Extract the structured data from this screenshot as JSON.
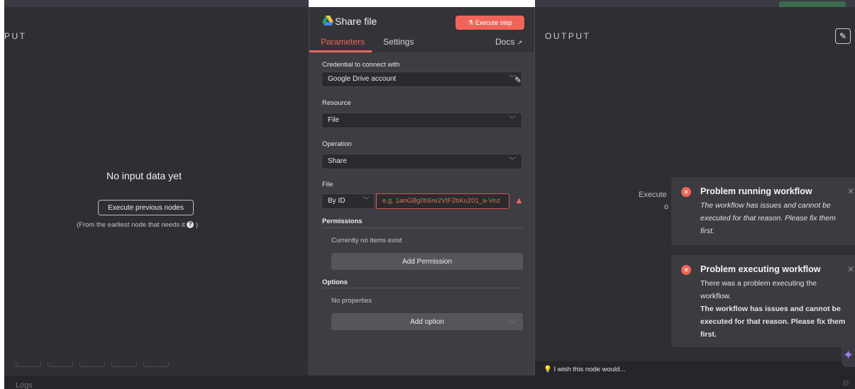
{
  "input_panel": {
    "heading": "PUT",
    "empty_title": "No input data yet",
    "execute_previous_label": "Execute previous nodes",
    "hint": "(From the earliest node that needs it",
    "hint_close": ")"
  },
  "output_panel": {
    "heading": "OUTPUT",
    "partial_text_1": "Execute",
    "partial_text_2": "o"
  },
  "node_modal": {
    "title": "Share file",
    "execute_step_label": "Execute step",
    "tabs": {
      "parameters": "Parameters",
      "settings": "Settings",
      "docs": "Docs"
    },
    "credential": {
      "label": "Credential to connect with",
      "value": "Google Drive account"
    },
    "resource": {
      "label": "Resource",
      "value": "File"
    },
    "operation": {
      "label": "Operation",
      "value": "Share"
    },
    "file": {
      "label": "File",
      "mode": "By ID",
      "placeholder": "e.g. 1anGBg0b5re2VtF2bKu201_a-Vnz"
    },
    "permissions": {
      "title": "Permissions",
      "empty": "Currently no items exist",
      "add_label": "Add Permission"
    },
    "options": {
      "title": "Options",
      "empty": "No properties",
      "add_label": "Add option"
    }
  },
  "toasts": [
    {
      "title": "Problem running workflow",
      "body": "The workflow has issues and cannot be executed for that reason. Please fix them first."
    },
    {
      "title": "Problem executing workflow",
      "body_1": "There was a problem executing the workflow.",
      "body_2": "The workflow has issues and cannot be executed for that reason. Please fix them first."
    }
  ],
  "footer": {
    "wish": "I wish this node would...",
    "logs": "Logs"
  },
  "colors": {
    "accent": "#f0645a",
    "panel": "#2e2e33",
    "modal": "#3d3d43"
  }
}
